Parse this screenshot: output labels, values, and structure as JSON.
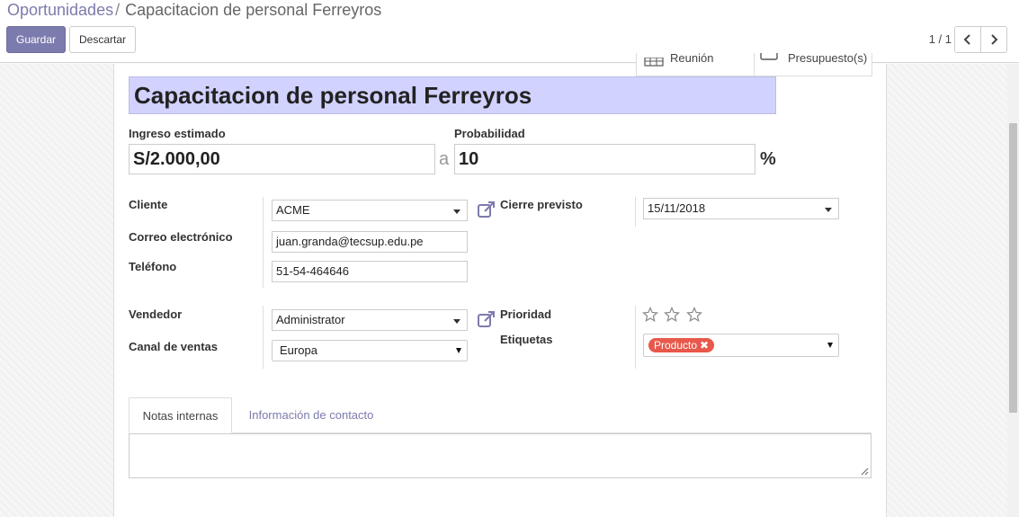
{
  "breadcrumb": {
    "parent": "Oportunidades",
    "separator": "/",
    "current": "Capacitacion de personal Ferreyros"
  },
  "toolbar": {
    "save_label": "Guardar",
    "discard_label": "Descartar"
  },
  "pager": {
    "value": "1 / 1"
  },
  "smart_buttons": {
    "meeting": "Reunión",
    "quotation": "Presupuesto(s)"
  },
  "form": {
    "title": "Capacitacion de personal Ferreyros",
    "expected_revenue_label": "Ingreso estimado",
    "expected_revenue": "S/2.000,00",
    "at_label": "a",
    "probability_label": "Probabilidad",
    "probability": "10",
    "percent": "%",
    "customer_label": "Cliente",
    "customer": "ACME",
    "email_label": "Correo electrónico",
    "email": "juan.granda@tecsup.edu.pe",
    "phone_label": "Teléfono",
    "phone": "51-54-464646",
    "closing_label": "Cierre previsto",
    "closing": "15/11/2018",
    "salesperson_label": "Vendedor",
    "salesperson": "Administrator",
    "sales_channel_label": "Canal de ventas",
    "sales_channel": "Europa",
    "priority_label": "Prioridad",
    "priority_stars": 0,
    "tags_label": "Etiquetas",
    "tags": [
      "Producto"
    ]
  },
  "tabs": [
    {
      "label": "Notas internas",
      "active": true
    },
    {
      "label": "Información de contacto",
      "active": false
    }
  ],
  "colors": {
    "primary": "#7c7bad",
    "title_bg": "#d2d2ff",
    "tag": "#e8584b"
  }
}
